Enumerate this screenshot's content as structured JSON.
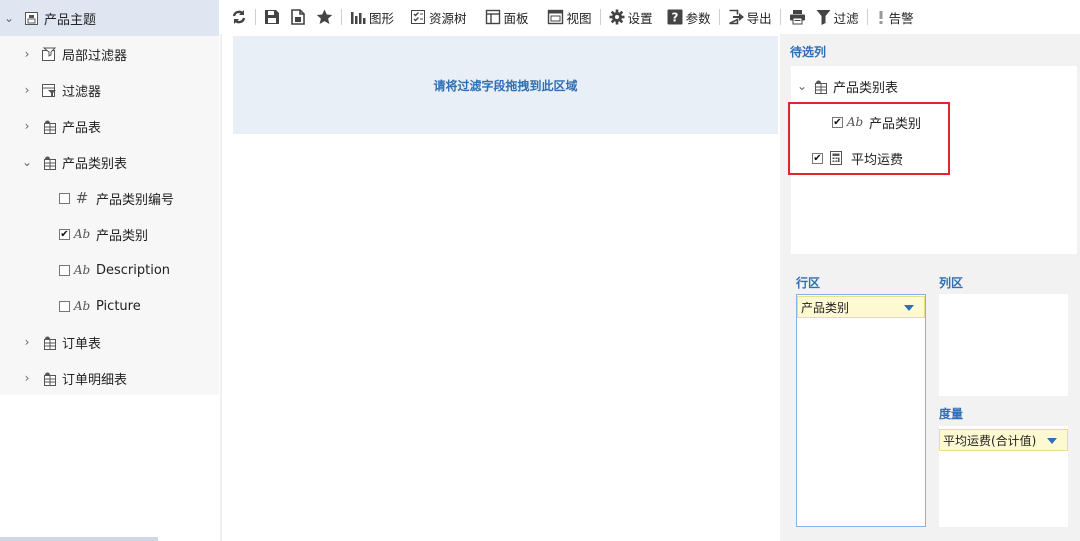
{
  "tree": {
    "root_label": "产品主题",
    "items": [
      {
        "label": "局部过滤器"
      },
      {
        "label": "过滤器"
      },
      {
        "label": "产品表"
      },
      {
        "label": "产品类别表"
      },
      {
        "label": "产品类别编号"
      },
      {
        "label": "产品类别"
      },
      {
        "label": "Description"
      },
      {
        "label": "Picture"
      },
      {
        "label": "订单表"
      },
      {
        "label": "订单明细表"
      }
    ],
    "checked_mark": "✔"
  },
  "toolbar": {
    "chart_label": "图形",
    "resource_tree_label": "资源树",
    "panel_label": "面板",
    "view_label": "视图",
    "settings_label": "设置",
    "params_label": "参数",
    "export_label": "导出",
    "filter_label": "过滤",
    "alert_label": "告警"
  },
  "center": {
    "dropzone_text": "请将过滤字段拖拽到此区域"
  },
  "right": {
    "candidate_title": "待选列",
    "candidate_table": "产品类别表",
    "candidate_field_1": "产品类别",
    "candidate_field_2": "平均运费",
    "row_area_title": "行区",
    "row_field": "产品类别",
    "col_area_title": "列区",
    "measure_title": "度量",
    "measure_field": "平均运费(合计值)"
  },
  "colors": {
    "accent": "#2f6fb3",
    "highlight_border": "#e3242b",
    "pill_bg": "#fdfad2",
    "selected_bg": "#dfe6f1"
  }
}
